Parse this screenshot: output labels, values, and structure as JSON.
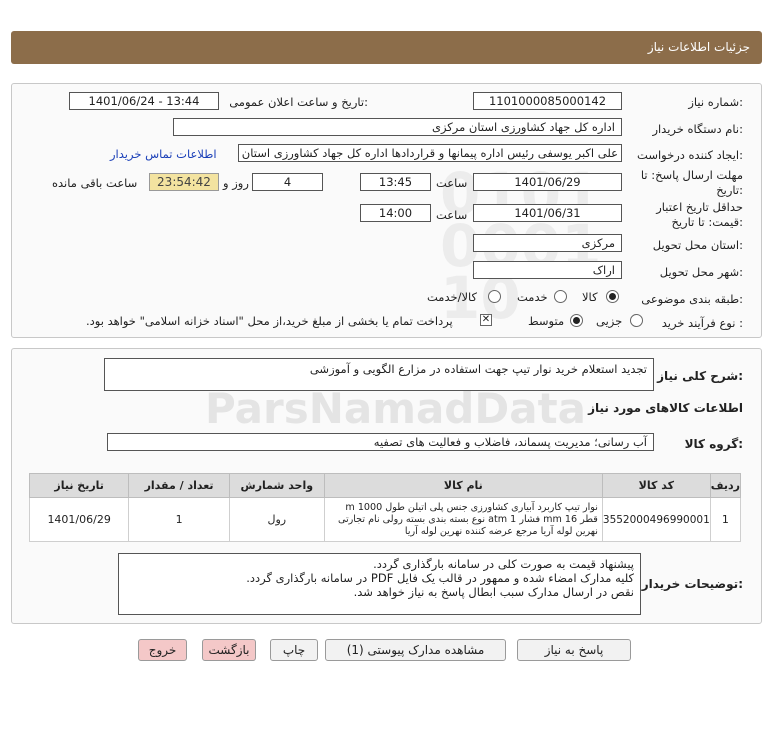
{
  "header": {
    "title": "جزئیات اطلاعات نیاز"
  },
  "form": {
    "need_number_label": "شماره نیاز:",
    "need_number": "1101000085000142",
    "announce_label": "تاریخ و ساعت اعلان عمومی:",
    "announce_value": "1401/06/24 - 13:44",
    "buyer_org_label": "نام دستگاه خریدار:",
    "buyer_org": "اداره کل جهاد کشاورزی استان مرکزی",
    "creator_label": "ایجاد کننده درخواست:",
    "creator": "علی اکبر یوسفی رئیس اداره پیمانها و قراردادها اداره کل جهاد کشاورزی استان",
    "contact_link": "اطلاعات تماس خریدار",
    "deadline_label_1": "مهلت ارسال پاسخ: تا",
    "deadline_label_2": "تاریخ:",
    "deadline_date": "1401/06/29",
    "time_label": "ساعت",
    "deadline_time": "13:45",
    "days_value": "4",
    "days_label": "روز و",
    "countdown": "23:54:42",
    "remaining_label": "ساعت باقی مانده",
    "validity_label_1": "حداقل تاریخ اعتبار",
    "validity_label_2": "قیمت: تا تاریخ:",
    "validity_date": "1401/06/31",
    "validity_time": "14:00",
    "province_label": "استان محل تحویل:",
    "province": "مرکزی",
    "city_label": "شهر محل تحویل:",
    "city": "اراک",
    "category_label": "طبقه بندی موضوعی:",
    "category_options": [
      "کالا",
      "خدمت",
      "کالا/خدمت"
    ],
    "process_label": "نوع فرآیند خرید :",
    "process_options": [
      "جزیی",
      "متوسط"
    ],
    "payment_note": "پرداخت تمام یا بخشی از مبلغ خرید،از محل \"اسناد خزانه اسلامی\" خواهد بود."
  },
  "summary": {
    "label": "شرح کلی نیاز:",
    "text": "تجدید استعلام خرید نوار تیپ  جهت استفاده در مزارع الگویی و آموزشی"
  },
  "goods": {
    "section_title": "اطلاعات کالاهای مورد نیاز",
    "group_label": "گروه کالا:",
    "group_value": "آب رسانی؛ مدیریت پسماند، فاضلاب و فعالیت های تصفیه",
    "columns": [
      "ردیف",
      "کد کالا",
      "نام کالا",
      "واحد شمارش",
      "تعداد / مقدار",
      "تاریخ نیاز"
    ],
    "rows": [
      {
        "row": "1",
        "code": "3552000496990001",
        "name": "نوار تیپ کاربرد آبیاری کشاورزی جنس پلی اتیلن طول 1000 m قطر 16 mm فشار 1 atm نوع بسته بندی بسته رولی نام تجارتی نهرین لوله آریا مرجع عرضه کننده نهرین لوله آریا",
        "unit": "رول",
        "qty": "1",
        "date": "1401/06/29"
      }
    ]
  },
  "buyer_notes": {
    "label": "توضیحات خریدار:",
    "lines": [
      "پیشنهاد قیمت به صورت کلی در سامانه بارگذاری گردد.",
      "کلیه مدارک امضاء شده و ممهور در قالب یک فایل PDF  در سامانه بارگذاری گردد.",
      "نقص در ارسال مدارک سبب ابطال پاسخ به نیاز خواهد شد."
    ]
  },
  "buttons": {
    "reply": "پاسخ به نیاز",
    "view_docs": "مشاهده مدارک پیوستی (1)",
    "print": "چاپ",
    "back": "بازگشت",
    "exit": "خروج"
  },
  "colors": {
    "header": "#8c6d4a",
    "countdown_bg": "#f3e3a0",
    "link": "#1a3fb8",
    "exit_btn": "#f4c8c8"
  }
}
